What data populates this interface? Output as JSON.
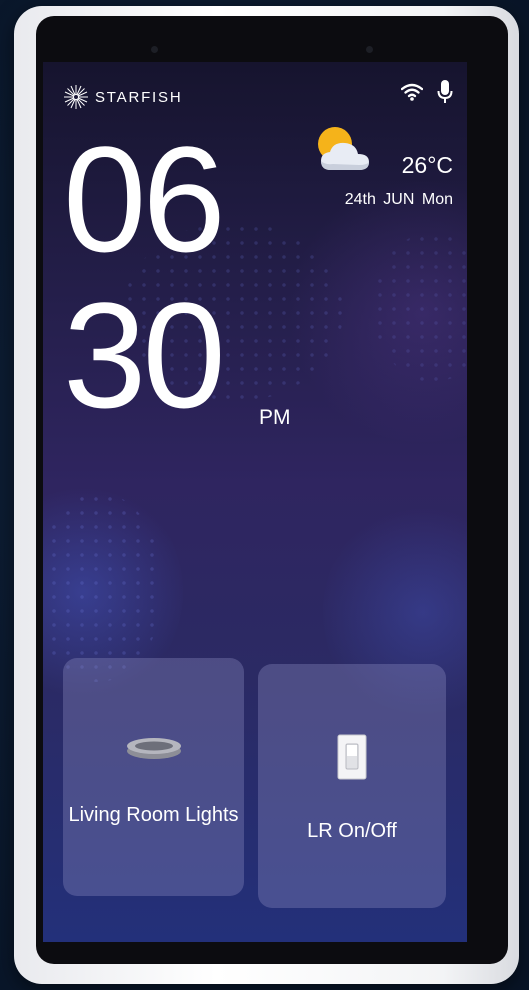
{
  "brand": {
    "name": "STARFISH"
  },
  "status_icons": [
    "wifi-icon",
    "microphone-icon"
  ],
  "clock": {
    "hours": "06",
    "minutes": "30",
    "period": "PM"
  },
  "weather": {
    "icon": "partly-cloudy-icon",
    "temperature": "26°C",
    "date": "24th JUN",
    "day": "Mon"
  },
  "tiles": [
    {
      "label": "Living Room Lights",
      "icon": "ceiling-light-icon"
    },
    {
      "label": "LR On/Off",
      "icon": "light-switch-icon"
    }
  ],
  "colors": {
    "screen_top": "#16142e",
    "screen_bottom": "#23307a",
    "tile_bg": "rgba(150,150,200,0.33)",
    "sun": "#f5b31a"
  }
}
